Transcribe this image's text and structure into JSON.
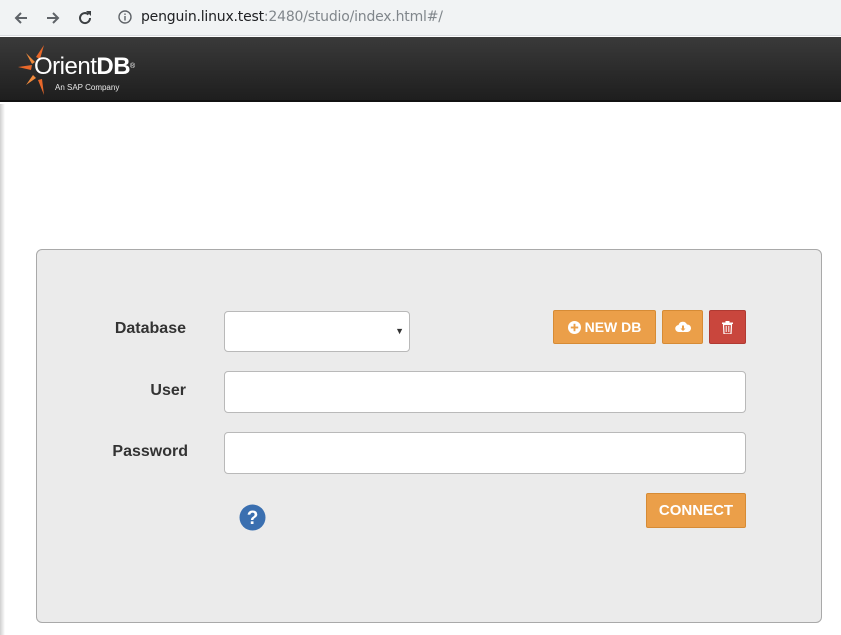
{
  "browser": {
    "url_host": "penguin.linux.test",
    "url_path": ":2480/studio/index.html#/"
  },
  "header": {
    "logo_main": "Orient",
    "logo_bold": "DB",
    "logo_reg": "®",
    "logo_sub": "An SAP Company"
  },
  "login": {
    "database_label": "Database",
    "database_value": "",
    "user_label": "User",
    "user_value": "",
    "user_placeholder": "",
    "password_label": "Password",
    "password_value": "",
    "password_placeholder": "",
    "new_db_label": "NEW DB",
    "connect_label": "CONNECT"
  },
  "icons": {
    "back": "arrow-left-icon",
    "forward": "arrow-right-icon",
    "reload": "reload-icon",
    "info": "info-icon",
    "new_db": "plus-circle-icon",
    "import": "cloud-download-icon",
    "delete": "trash-icon",
    "help": "question-circle-icon"
  },
  "colors": {
    "accent_orange": "#eb9f49",
    "danger_red": "#c9463d",
    "help_blue": "#3a6fb0",
    "logo_star": "#e8682a"
  }
}
